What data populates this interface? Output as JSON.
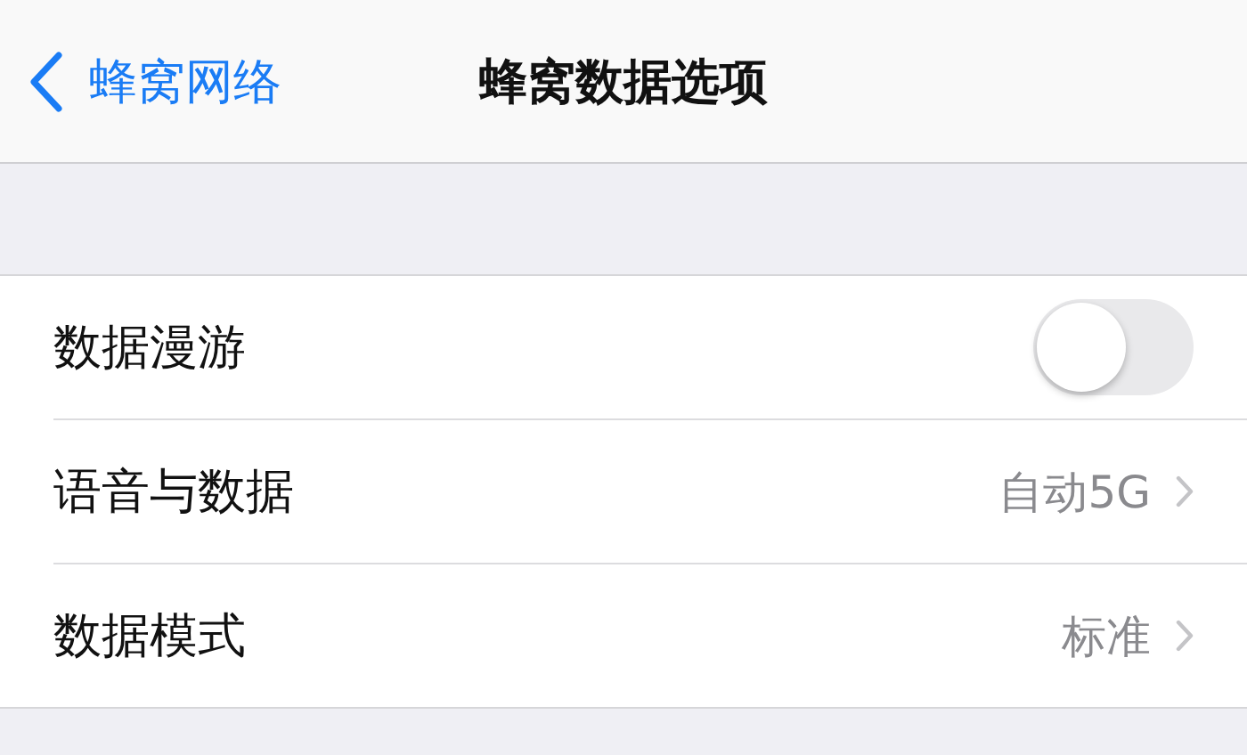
{
  "nav": {
    "back": "蜂窝网络",
    "title": "蜂窝数据选项"
  },
  "rows": [
    {
      "kind": "toggle",
      "label": "数据漫游",
      "on": false
    },
    {
      "kind": "link",
      "label": "语音与数据",
      "value": "自动5G"
    },
    {
      "kind": "link",
      "label": "数据模式",
      "value": "标准"
    }
  ]
}
